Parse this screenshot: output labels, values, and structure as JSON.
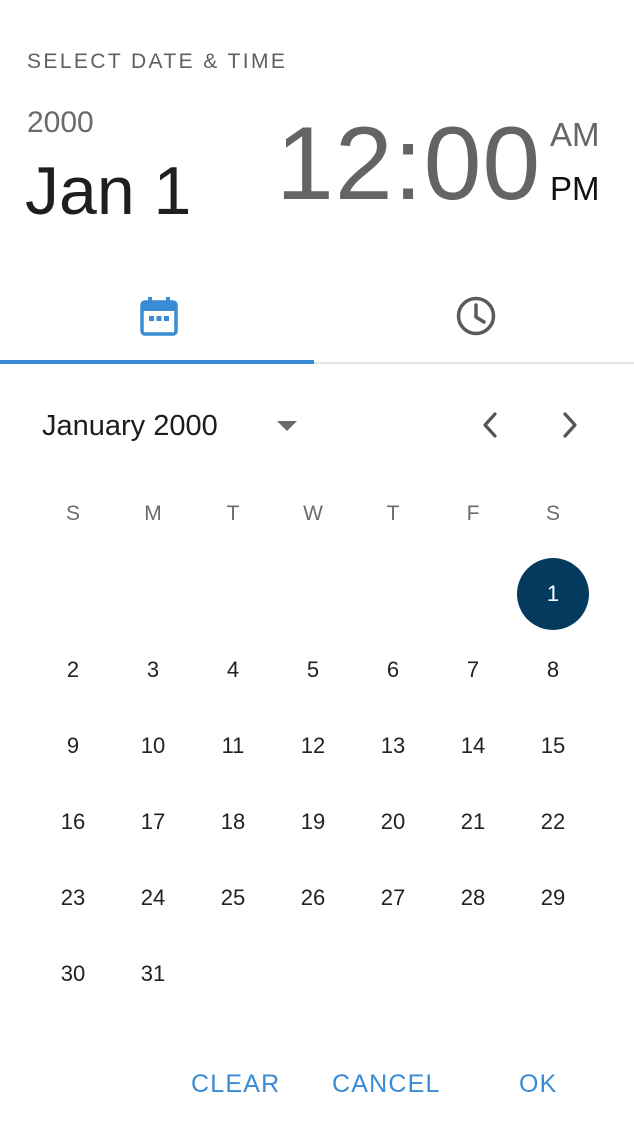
{
  "header": {
    "label": "SELECT DATE & TIME",
    "year": "2000",
    "date": "Jan 1",
    "time": "12:00",
    "am": "AM",
    "pm": "PM",
    "selected_period": "PM"
  },
  "tabs": [
    {
      "name": "date",
      "icon": "calendar-icon",
      "active": true
    },
    {
      "name": "time",
      "icon": "clock-icon",
      "active": false
    }
  ],
  "calendar": {
    "month_label": "January 2000",
    "weekdays": [
      "S",
      "M",
      "T",
      "W",
      "T",
      "F",
      "S"
    ],
    "first_weekday_index": 6,
    "days_in_month": 31,
    "selected_day": 1,
    "days": [
      "1",
      "2",
      "3",
      "4",
      "5",
      "6",
      "7",
      "8",
      "9",
      "10",
      "11",
      "12",
      "13",
      "14",
      "15",
      "16",
      "17",
      "18",
      "19",
      "20",
      "21",
      "22",
      "23",
      "24",
      "25",
      "26",
      "27",
      "28",
      "29",
      "30",
      "31"
    ]
  },
  "actions": {
    "clear": "CLEAR",
    "cancel": "CANCEL",
    "ok": "OK"
  },
  "colors": {
    "accent": "#3a8bd6",
    "selected_day": "#033a5e",
    "muted_text": "#646464"
  }
}
